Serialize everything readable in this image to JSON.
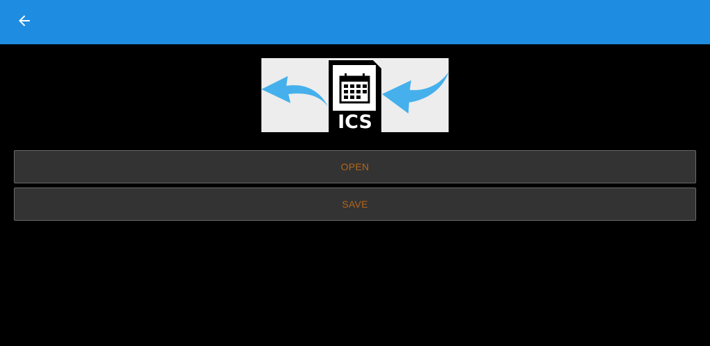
{
  "app_bar": {
    "background_color": "#1E8CE0",
    "back_icon": "arrow-left-icon"
  },
  "banner": {
    "file_label": "ICS",
    "icons": [
      "curved-arrow-left-icon",
      "ics-file-icon",
      "curved-arrow-right-icon"
    ],
    "arrow_color": "#45B0EC",
    "file_color": "#000000"
  },
  "actions": {
    "open_label": "OPEN",
    "save_label": "SAVE",
    "text_color": "#B5651D",
    "button_color": "#333333"
  }
}
